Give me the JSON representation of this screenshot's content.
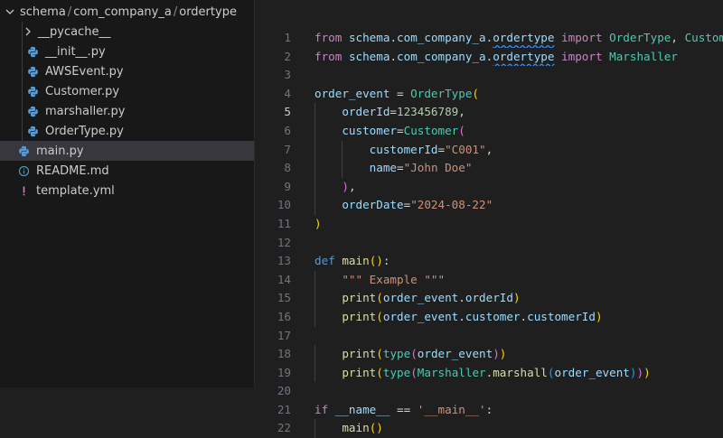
{
  "explorer": {
    "breadcrumb": [
      "schema",
      "com_company_a",
      "ordertype"
    ],
    "items": [
      {
        "label": "__pycache__",
        "type": "folder"
      },
      {
        "label": "__init__.py",
        "type": "python"
      },
      {
        "label": "AWSEvent.py",
        "type": "python"
      },
      {
        "label": "Customer.py",
        "type": "python"
      },
      {
        "label": "marshaller.py",
        "type": "python"
      },
      {
        "label": "OrderType.py",
        "type": "python"
      },
      {
        "label": "main.py",
        "type": "python"
      },
      {
        "label": "README.md",
        "type": "info"
      },
      {
        "label": "template.yml",
        "type": "yaml"
      }
    ]
  },
  "editor": {
    "active_line": 5,
    "lines": [
      [
        [
          "kw",
          "from"
        ],
        [
          "pl",
          " "
        ],
        [
          "mod",
          "schema"
        ],
        [
          "pl",
          "."
        ],
        [
          "mod",
          "com_company_a"
        ],
        [
          "pl",
          "."
        ],
        [
          "modsq",
          "ordertype"
        ],
        [
          "pl",
          " "
        ],
        [
          "kw",
          "import"
        ],
        [
          "pl",
          " "
        ],
        [
          "cls",
          "OrderType"
        ],
        [
          "pl",
          ", "
        ],
        [
          "cls",
          "Customer"
        ]
      ],
      [
        [
          "kw",
          "from"
        ],
        [
          "pl",
          " "
        ],
        [
          "mod",
          "schema"
        ],
        [
          "pl",
          "."
        ],
        [
          "mod",
          "com_company_a"
        ],
        [
          "pl",
          "."
        ],
        [
          "modsq",
          "ordertype"
        ],
        [
          "pl",
          " "
        ],
        [
          "kw",
          "import"
        ],
        [
          "pl",
          " "
        ],
        [
          "cls",
          "Marshaller"
        ]
      ],
      [],
      [
        [
          "var",
          "order_event"
        ],
        [
          "pl",
          " = "
        ],
        [
          "cls",
          "OrderType"
        ],
        [
          "br1",
          "("
        ]
      ],
      [
        [
          "pl",
          "    "
        ],
        [
          "var",
          "orderId"
        ],
        [
          "pl",
          "="
        ],
        [
          "num",
          "123456789"
        ],
        [
          "pl",
          ","
        ]
      ],
      [
        [
          "pl",
          "    "
        ],
        [
          "var",
          "customer"
        ],
        [
          "pl",
          "="
        ],
        [
          "cls",
          "Customer"
        ],
        [
          "br2",
          "("
        ]
      ],
      [
        [
          "pl",
          "        "
        ],
        [
          "var",
          "customerId"
        ],
        [
          "pl",
          "="
        ],
        [
          "str",
          "\"C001\""
        ],
        [
          "pl",
          ","
        ]
      ],
      [
        [
          "pl",
          "        "
        ],
        [
          "var",
          "name"
        ],
        [
          "pl",
          "="
        ],
        [
          "str",
          "\"John Doe\""
        ]
      ],
      [
        [
          "pl",
          "    "
        ],
        [
          "br2",
          ")"
        ],
        [
          "pl",
          ","
        ]
      ],
      [
        [
          "pl",
          "    "
        ],
        [
          "var",
          "orderDate"
        ],
        [
          "pl",
          "="
        ],
        [
          "str",
          "\"2024-08-22\""
        ]
      ],
      [
        [
          "br1",
          ")"
        ]
      ],
      [],
      [
        [
          "kwd",
          "def"
        ],
        [
          "pl",
          " "
        ],
        [
          "fn",
          "main"
        ],
        [
          "br1",
          "("
        ],
        [
          "br1",
          ")"
        ],
        [
          "pl",
          ":"
        ]
      ],
      [
        [
          "pl",
          "    "
        ],
        [
          "str",
          "\"\"\" Example \"\"\""
        ]
      ],
      [
        [
          "pl",
          "    "
        ],
        [
          "fn",
          "print"
        ],
        [
          "br1",
          "("
        ],
        [
          "var",
          "order_event"
        ],
        [
          "pl",
          "."
        ],
        [
          "var",
          "orderId"
        ],
        [
          "br1",
          ")"
        ]
      ],
      [
        [
          "pl",
          "    "
        ],
        [
          "fn",
          "print"
        ],
        [
          "br1",
          "("
        ],
        [
          "var",
          "order_event"
        ],
        [
          "pl",
          "."
        ],
        [
          "var",
          "customer"
        ],
        [
          "pl",
          "."
        ],
        [
          "var",
          "customerId"
        ],
        [
          "br1",
          ")"
        ]
      ],
      [],
      [
        [
          "pl",
          "    "
        ],
        [
          "fn",
          "print"
        ],
        [
          "br1",
          "("
        ],
        [
          "cls",
          "type"
        ],
        [
          "br2",
          "("
        ],
        [
          "var",
          "order_event"
        ],
        [
          "br2",
          ")"
        ],
        [
          "br1",
          ")"
        ]
      ],
      [
        [
          "pl",
          "    "
        ],
        [
          "fn",
          "print"
        ],
        [
          "br1",
          "("
        ],
        [
          "cls",
          "type"
        ],
        [
          "br2",
          "("
        ],
        [
          "cls",
          "Marshaller"
        ],
        [
          "pl",
          "."
        ],
        [
          "fn",
          "marshall"
        ],
        [
          "br3",
          "("
        ],
        [
          "var",
          "order_event"
        ],
        [
          "br3",
          ")"
        ],
        [
          "br2",
          ")"
        ],
        [
          "br1",
          ")"
        ]
      ],
      [],
      [
        [
          "kw",
          "if"
        ],
        [
          "pl",
          " "
        ],
        [
          "var",
          "__name__"
        ],
        [
          "pl",
          " == "
        ],
        [
          "str",
          "'__main__'"
        ],
        [
          "pl",
          ":"
        ]
      ],
      [
        [
          "pl",
          "    "
        ],
        [
          "fn",
          "main"
        ],
        [
          "br1",
          "("
        ],
        [
          "br1",
          ")"
        ]
      ]
    ]
  }
}
